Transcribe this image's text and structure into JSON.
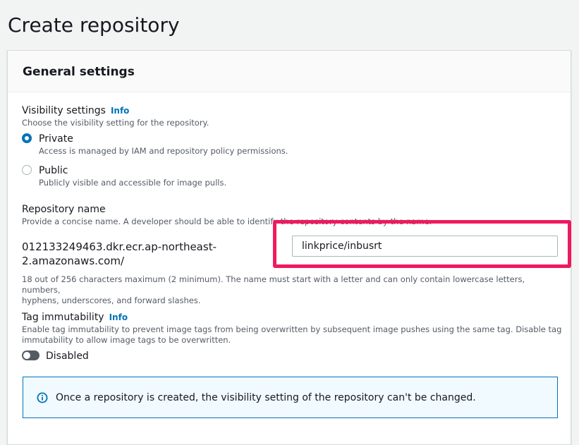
{
  "page": {
    "title": "Create repository"
  },
  "panel": {
    "title": "General settings"
  },
  "visibility": {
    "label": "Visibility settings",
    "info": "Info",
    "description": "Choose the visibility setting for the repository.",
    "options": [
      {
        "label": "Private",
        "description": "Access is managed by IAM and repository policy permissions.",
        "checked": true
      },
      {
        "label": "Public",
        "description": "Publicly visible and accessible for image pulls.",
        "checked": false
      }
    ]
  },
  "repo_name": {
    "label": "Repository name",
    "description": "Provide a concise name. A developer should be able to identify the repository contents by the name.",
    "prefix_line1": "012133249463.dkr.ecr.ap-northeast-",
    "prefix_line2": "2.amazonaws.com/",
    "value": "linkprice/inbusrt",
    "constraint_line1": "18 out of 256 characters maximum (2 minimum). The name must start with a letter and can only contain lowercase letters, numbers,",
    "constraint_line2": "hyphens, underscores, and forward slashes."
  },
  "tag_immutability": {
    "label": "Tag immutability",
    "info": "Info",
    "description_line1": "Enable tag immutability to prevent image tags from being overwritten by subsequent image pushes using the same tag. Disable tag",
    "description_line2": "immutability to allow image tags to be overwritten.",
    "toggle_label": "Disabled",
    "enabled": false
  },
  "alert": {
    "text": "Once a repository is created, the visibility setting of the repository can't be changed.",
    "icon": "info-icon"
  },
  "colors": {
    "accent": "#0073bb",
    "highlight": "#ef1a5e",
    "background": "#f2f3f3"
  }
}
